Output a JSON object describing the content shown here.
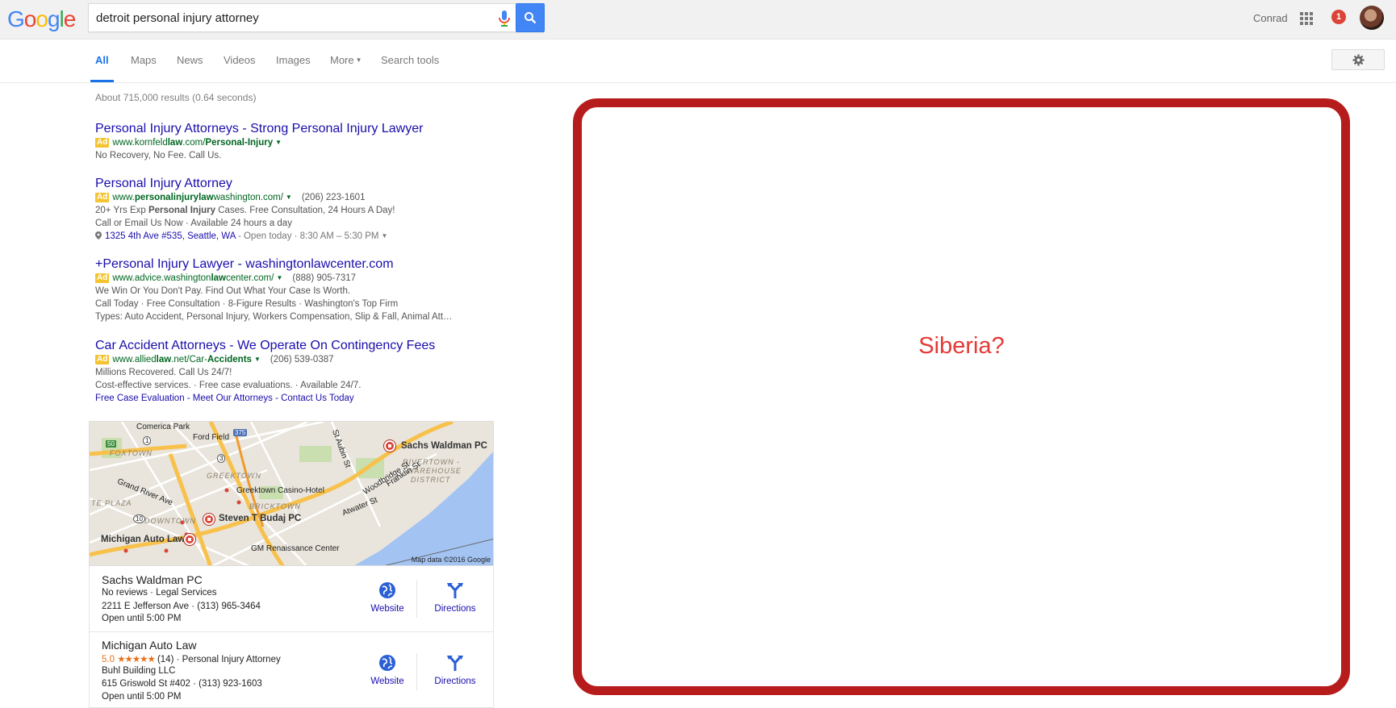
{
  "header": {
    "logo": "Google",
    "search_query": "detroit personal injury attorney",
    "user_name": "Conrad",
    "notification_count": "1"
  },
  "tabs": [
    {
      "label": "All"
    },
    {
      "label": "Maps"
    },
    {
      "label": "News"
    },
    {
      "label": "Videos"
    },
    {
      "label": "Images"
    },
    {
      "label": "More"
    },
    {
      "label": "Search tools"
    }
  ],
  "results": {
    "stats": "About 715,000 results (0.64 seconds)",
    "ad_badge": "Ad",
    "ads": [
      {
        "title": "Personal Injury Attorneys - Strong Personal Injury Lawyer",
        "url_pre": "www.kornfeld",
        "url_bold": "law",
        "url_post": ".com/",
        "url_bold2": "Personal-Injury",
        "lines": [
          "No Recovery, No Fee. Call Us."
        ]
      },
      {
        "title": "Personal Injury Attorney",
        "url_pre": "www.",
        "url_bold": "personalinjurylaw",
        "url_post": "washington.com/",
        "phone": "(206) 223-1601",
        "line1_pre": "20+ Yrs Exp ",
        "line1_bold": "Personal Injury",
        "line1_post": " Cases. Free Consultation, 24 Hours A Day!",
        "line2": "Call or Email Us Now · Available 24 hours a day",
        "address": "1325 4th Ave #535, Seattle, WA",
        "hours": " - Open today · 8:30 AM – 5:30 PM"
      },
      {
        "title": "+Personal Injury Lawyer - washingtonlawcenter.com",
        "url_pre": "www.advice.washington",
        "url_bold": "law",
        "url_post": "center.com/",
        "phone": "(888) 905-7317",
        "lines": [
          "We Win Or You Don't Pay. Find Out What Your Case Is Worth.",
          "Call Today · Free Consultation · 8-Figure Results · Washington's Top Firm",
          "Types: Auto Accident, Personal Injury, Workers Compensation, Slip & Fall, Animal Att…"
        ]
      },
      {
        "title": "Car Accident Attorneys - We Operate On Contingency Fees",
        "url_pre": "www.allied",
        "url_bold": "law",
        "url_post": ".net/Car-",
        "url_bold2": "Accidents",
        "phone": "(206) 539-0387",
        "lines": [
          "Millions Recovered. Call Us 24/7!",
          "Cost-effective services. · Free case evaluations. · Available 24/7."
        ],
        "sitelinks": "Free Case Evaluation - Meet Our Attorneys - Contact Us Today"
      }
    ]
  },
  "map": {
    "labels": {
      "comerica": "Comerica Park",
      "ford": "Ford Field",
      "foxtown": "FOXTOWN",
      "greektown": "GREEKTOWN",
      "casino": "Greektown Casino-Hotel",
      "grand_river": "Grand River Ave",
      "te_plaza": "TE PLAZA",
      "downtown": "DOWNTOWN",
      "bricktown": "BRICKTOWN",
      "rivertown1": "RIVERTOWN -",
      "rivertown2": "WAREHOUSE",
      "rivertown3": "DISTRICT",
      "woodbridge": "Woodbridge St",
      "franklin": "Franklin St",
      "atwater": "Atwater St",
      "auburn": "St Aubin St",
      "gm": "GM Renaissance Center",
      "sachs": "Sachs Waldman PC",
      "budaj": "Steven T Budaj PC",
      "michigan": "Michigan Auto Law",
      "shield_375": "375",
      "shield_50": "50",
      "shield_1": "1",
      "shield_3": "3",
      "shield_10": "10"
    },
    "attribution": "Map data ©2016 Google"
  },
  "listings": [
    {
      "name": "Sachs Waldman PC",
      "meta": "No reviews · Legal Services",
      "address": "2211 E Jefferson Ave · (313) 965-3464",
      "hours": "Open until 5:00 PM",
      "website": "Website",
      "directions": "Directions"
    },
    {
      "name": "Michigan Auto Law",
      "rating": "5.0",
      "stars": "★★★★★",
      "meta": " (14) · Personal Injury Attorney",
      "building": "Buhl Building LLC",
      "address": "615 Griswold St #402 · (313) 923-1603",
      "hours": "Open until 5:00 PM",
      "website": "Website",
      "directions": "Directions"
    }
  ],
  "callout": {
    "text": "Siberia?",
    "border_color": "#b71c1c",
    "text_color": "#e53935"
  }
}
